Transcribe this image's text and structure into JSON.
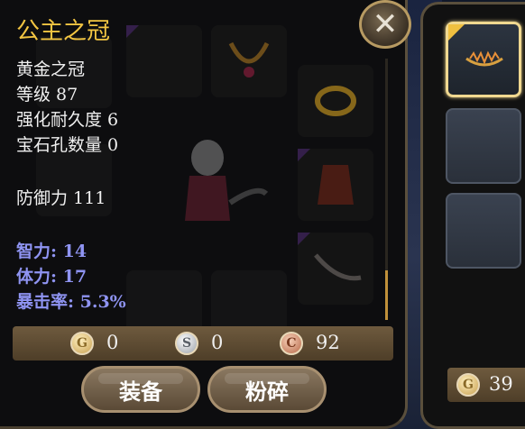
{
  "item": {
    "name": "公主之冠",
    "subtitle": "黄金之冠",
    "level": "等级 87",
    "durability": "强化耐久度 6",
    "sockets": "宝石孔数量 0",
    "defense": "防御力 111",
    "stats": [
      "智力: 14",
      "体力: 17",
      "暴击率: 5.3%"
    ]
  },
  "currency": {
    "gold": "0",
    "silver": "0",
    "copper": "92",
    "gold_symbol": "G",
    "silver_symbol": "S",
    "copper_symbol": "C"
  },
  "buttons": {
    "equip": "装备",
    "smash": "粉碎",
    "close": "✕"
  },
  "right_panel": {
    "gold": "39",
    "gold_symbol": "G"
  },
  "colors": {
    "title": "#f2c542",
    "stat": "#8f94f2",
    "accent": "#f0d890"
  }
}
